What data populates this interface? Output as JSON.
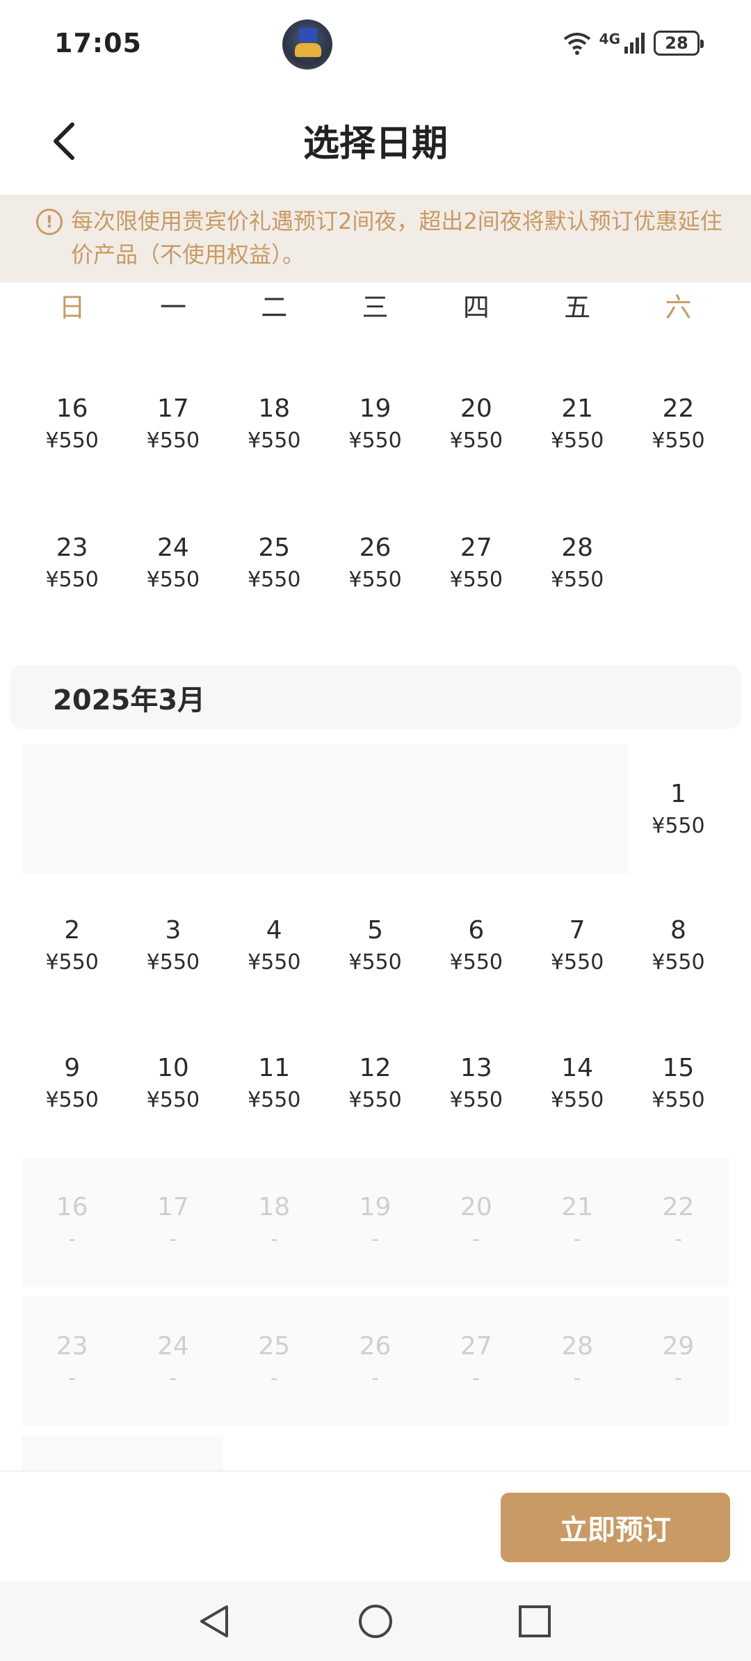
{
  "status": {
    "time": "17:05",
    "network": "4G",
    "battery": "28"
  },
  "header": {
    "title": "选择日期"
  },
  "notice": {
    "text": "每次限使用贵宾价礼遇预订2间夜，超出2间夜将默认预订优惠延住价产品（不使用权益）。"
  },
  "weekdays": [
    "日",
    "一",
    "二",
    "三",
    "四",
    "五",
    "六"
  ],
  "feb_rows": [
    [
      {
        "day": "16",
        "price": "¥550"
      },
      {
        "day": "17",
        "price": "¥550"
      },
      {
        "day": "18",
        "price": "¥550"
      },
      {
        "day": "19",
        "price": "¥550"
      },
      {
        "day": "20",
        "price": "¥550"
      },
      {
        "day": "21",
        "price": "¥550"
      },
      {
        "day": "22",
        "price": "¥550"
      }
    ],
    [
      {
        "day": "23",
        "price": "¥550"
      },
      {
        "day": "24",
        "price": "¥550"
      },
      {
        "day": "25",
        "price": "¥550"
      },
      {
        "day": "26",
        "price": "¥550"
      },
      {
        "day": "27",
        "price": "¥550"
      },
      {
        "day": "28",
        "price": "¥550"
      }
    ]
  ],
  "march": {
    "title": "2025年3月",
    "first": {
      "day": "1",
      "price": "¥550"
    },
    "rows": [
      [
        {
          "day": "2",
          "price": "¥550"
        },
        {
          "day": "3",
          "price": "¥550"
        },
        {
          "day": "4",
          "price": "¥550"
        },
        {
          "day": "5",
          "price": "¥550"
        },
        {
          "day": "6",
          "price": "¥550"
        },
        {
          "day": "7",
          "price": "¥550"
        },
        {
          "day": "8",
          "price": "¥550"
        }
      ],
      [
        {
          "day": "9",
          "price": "¥550"
        },
        {
          "day": "10",
          "price": "¥550"
        },
        {
          "day": "11",
          "price": "¥550"
        },
        {
          "day": "12",
          "price": "¥550"
        },
        {
          "day": "13",
          "price": "¥550"
        },
        {
          "day": "14",
          "price": "¥550"
        },
        {
          "day": "15",
          "price": "¥550"
        }
      ]
    ],
    "disabled_rows": [
      [
        {
          "day": "16",
          "price": "-"
        },
        {
          "day": "17",
          "price": "-"
        },
        {
          "day": "18",
          "price": "-"
        },
        {
          "day": "19",
          "price": "-"
        },
        {
          "day": "20",
          "price": "-"
        },
        {
          "day": "21",
          "price": "-"
        },
        {
          "day": "22",
          "price": "-"
        }
      ],
      [
        {
          "day": "23",
          "price": "-"
        },
        {
          "day": "24",
          "price": "-"
        },
        {
          "day": "25",
          "price": "-"
        },
        {
          "day": "26",
          "price": "-"
        },
        {
          "day": "27",
          "price": "-"
        },
        {
          "day": "28",
          "price": "-"
        },
        {
          "day": "29",
          "price": "-"
        }
      ]
    ]
  },
  "actions": {
    "book_label": "立即预订"
  },
  "colors": {
    "accent": "#c99a64",
    "notice_bg": "#f1ece6"
  }
}
